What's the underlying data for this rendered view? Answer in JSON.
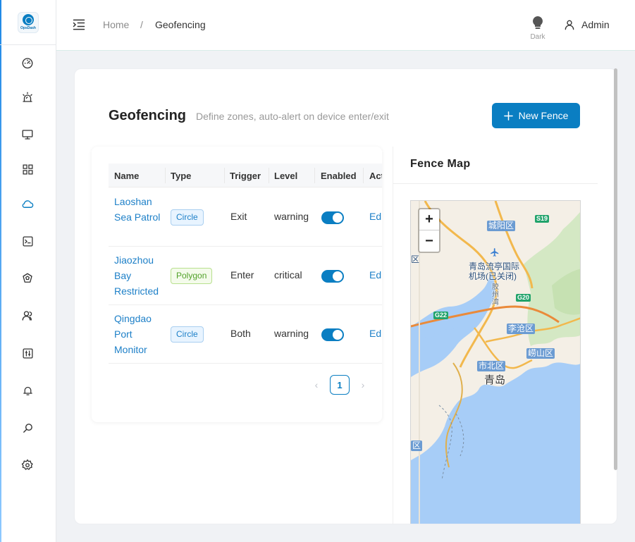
{
  "app": {
    "logo_text": "OpsDash"
  },
  "breadcrumb": {
    "home": "Home",
    "separator": "/",
    "current": "Geofencing"
  },
  "header": {
    "theme_label": "Dark",
    "user_name": "Admin"
  },
  "page": {
    "title": "Geofencing",
    "description": "Define zones, auto-alert on device enter/exit",
    "new_button_label": "New Fence"
  },
  "table": {
    "columns": [
      "Name",
      "Type",
      "Trigger",
      "Level",
      "Enabled",
      "Actio"
    ],
    "rows": [
      {
        "name": "Laoshan Sea Patrol",
        "type": "Circle",
        "trigger": "Exit",
        "level": "warning",
        "enabled": true,
        "action": "Edit"
      },
      {
        "name": "Jiaozhou Bay Restricted",
        "type": "Polygon",
        "trigger": "Enter",
        "level": "critical",
        "enabled": true,
        "action": "Edit"
      },
      {
        "name": "Qingdao Port Monitor",
        "type": "Circle",
        "trigger": "Both",
        "level": "warning",
        "enabled": true,
        "action": "Edit"
      }
    ]
  },
  "pagination": {
    "current_page": "1"
  },
  "map": {
    "title": "Fence Map",
    "zoom_in": "+",
    "zoom_out": "−",
    "labels": {
      "chengyang": "城阳区",
      "airport_line1": "青岛流亭国际",
      "airport_line2": "机场(已关闭)",
      "licang": "李沧区",
      "laoshan": "崂山区",
      "shibei": "市北区",
      "city": "青岛",
      "edge_district": "区",
      "edge_district_2": "区",
      "road_s19": "S19",
      "road_g20": "G20",
      "road_g22": "G22",
      "vertical_label": "胶州湾"
    }
  },
  "colors": {
    "primary": "#0a7ec2",
    "tag_green": "#52a22a",
    "map_water": "#a7cdf7"
  },
  "icons": {
    "nav": [
      "dashboard-icon",
      "alarm-icon",
      "monitor-icon",
      "apps-icon",
      "cloud-icon",
      "terminal-icon",
      "shield-icon",
      "users-icon",
      "sliders-icon",
      "bell-icon",
      "search-icon",
      "gear-icon"
    ]
  }
}
